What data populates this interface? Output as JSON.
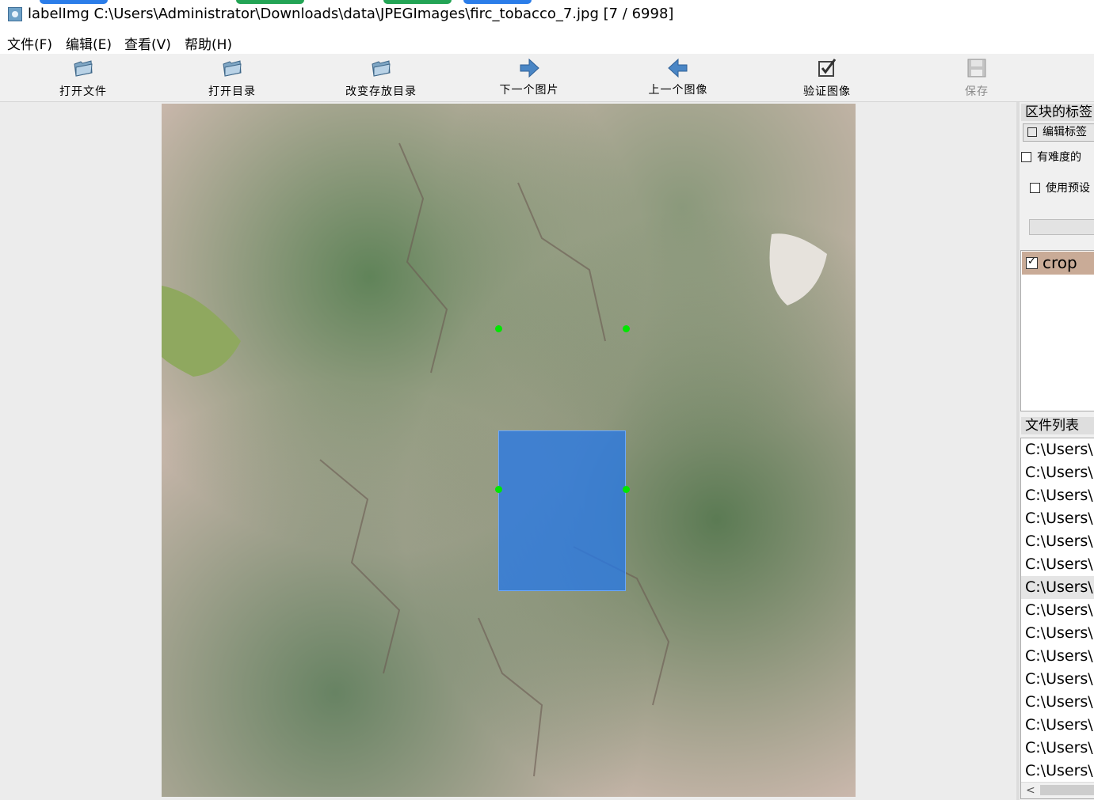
{
  "window": {
    "title": "labelImg C:\\Users\\Administrator\\Downloads\\data\\JPEGImages\\firc_tobacco_7.jpg [7 / 6998]"
  },
  "menu": [
    "文件(F)",
    "编辑(E)",
    "查看(V)",
    "帮助(H)"
  ],
  "toolbar": {
    "open_file": "打开文件",
    "open_dir": "打开目录",
    "change_save_dir": "改变存放目录",
    "next_image": "下一个图片",
    "prev_image": "上一个图像",
    "verify_image": "验证图像",
    "save": "保存"
  },
  "canvas": {
    "annotation_label": "crop",
    "box_color": "#2878e6",
    "vertex_color": "#00e600"
  },
  "sidebar": {
    "box_labels_title": "区块的标签",
    "edit_label_button": "编辑标签",
    "difficult_checkbox": "有难度的",
    "use_default_label": "使用预设",
    "labels": [
      {
        "name": "crop",
        "checked": true
      }
    ],
    "file_list_title": "文件列表",
    "files": [
      "C:\\Users\\",
      "C:\\Users\\",
      "C:\\Users\\",
      "C:\\Users\\",
      "C:\\Users\\",
      "C:\\Users\\",
      "C:\\Users\\",
      "C:\\Users\\",
      "C:\\Users\\",
      "C:\\Users\\",
      "C:\\Users\\",
      "C:\\Users\\",
      "C:\\Users\\",
      "C:\\Users\\",
      "C:\\Users\\"
    ],
    "selected_file_index": 6
  }
}
